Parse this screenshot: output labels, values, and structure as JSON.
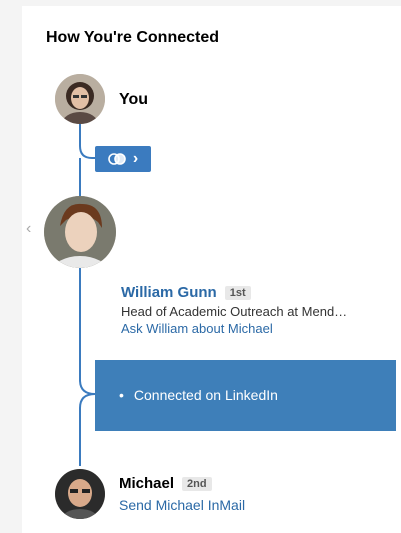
{
  "header": {
    "title": "How You're Connected"
  },
  "you": {
    "label": "You",
    "avatar_icon": "person-photo-you"
  },
  "shared_connections_button": {
    "icon": "shared-circles-icon",
    "chevron": "›"
  },
  "nav": {
    "prev_chevron": "‹"
  },
  "intermediary": {
    "name": "William Gunn",
    "degree": "1st",
    "headline": "Head of Academic Outreach at Mend…",
    "ask_link": "Ask William about Michael"
  },
  "connection_box": {
    "bullet": "•",
    "text": "Connected on LinkedIn"
  },
  "target": {
    "name": "Michael",
    "degree": "2nd",
    "inmail_link": "Send Michael InMail"
  },
  "colors": {
    "accent": "#3b7bbf",
    "link": "#2b69a6",
    "line": "#3b7bbf"
  }
}
